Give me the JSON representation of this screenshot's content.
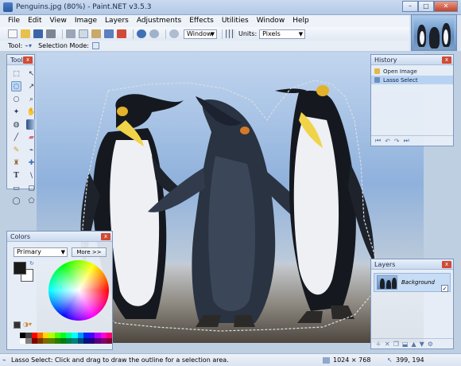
{
  "window": {
    "title": "Penguins.jpg (80%) - Paint.NET v3.5.3",
    "minimize_glyph": "–",
    "maximize_glyph": "□",
    "close_glyph": "✕"
  },
  "menu": [
    "File",
    "Edit",
    "View",
    "Image",
    "Layers",
    "Adjustments",
    "Effects",
    "Utilities",
    "Window",
    "Help"
  ],
  "toolbar": {
    "zoom_value": "Window",
    "units_label": "Units:",
    "units_value": "Pixels",
    "tool_label": "Tool:",
    "selection_mode_label": "Selection Mode:"
  },
  "tools_panel": {
    "title": "Tools",
    "tools": [
      "rectangle-select",
      "move-selected-pixels",
      "lasso-select",
      "move-selection",
      "ellipse-select",
      "zoom",
      "magic-wand",
      "pan",
      "paint-bucket",
      "gradient",
      "paintbrush",
      "eraser",
      "pencil",
      "color-picker",
      "clone-stamp",
      "recolor",
      "text",
      "line-curve",
      "rectangle",
      "rounded-rectangle",
      "ellipse",
      "freeform-shape"
    ],
    "selected": "lasso-select"
  },
  "history_panel": {
    "title": "History",
    "items": [
      {
        "label": "Open Image",
        "selected": false
      },
      {
        "label": "Lasso Select",
        "selected": true
      }
    ]
  },
  "layers_panel": {
    "title": "Layers",
    "layers": [
      {
        "name": "Background",
        "visible": true
      }
    ]
  },
  "colors_panel": {
    "title": "Colors",
    "mode_value": "Primary",
    "more_button": "More >>",
    "primary_color": "#1a1a1a",
    "secondary_color": "#ffffff"
  },
  "status": {
    "hint": "Lasso Select: Click and drag to draw the outline for a selection area.",
    "image_size": "1024 × 768",
    "cursor_pos": "399, 194"
  },
  "colors": {
    "accent": "#3a6fb8",
    "close_red": "#d24a33"
  }
}
